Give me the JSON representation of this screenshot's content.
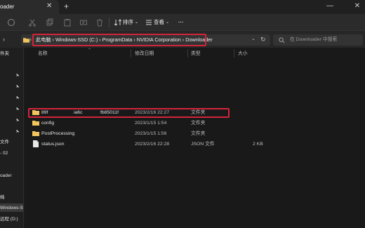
{
  "window": {
    "tab_title": "oader"
  },
  "toolbar": {
    "sort_label": "排序",
    "view_label": "查看",
    "more_label": "···"
  },
  "address": {
    "path": "此电脑 › Windows-SSD (C:) › ProgramData › NVIDIA Corporation › Downloader",
    "search_placeholder": "在 Downloader 中搜索"
  },
  "sidebar": {
    "items": [
      {
        "label": "件夹"
      },
      {
        "label": "文件"
      },
      {
        "label": "- 02"
      },
      {
        "label": "oader"
      },
      {
        "label": "椅"
      },
      {
        "label": "Windows-SSD"
      },
      {
        "label": "远程 (D:)"
      }
    ]
  },
  "columns": {
    "name": "名称",
    "modified": "修改日期",
    "type": "类型",
    "size": "大小"
  },
  "files": [
    {
      "name": "89f",
      "name_mid": "ia6c",
      "name_end": "fb85011f",
      "modified": "2023/2/16 22:27",
      "type": "文件夹",
      "size": "",
      "kind": "folder"
    },
    {
      "name": "config",
      "modified": "2023/1/15 1:54",
      "type": "文件夹",
      "size": "",
      "kind": "folder"
    },
    {
      "name": "PostProcessing",
      "modified": "2023/1/15 1:56",
      "type": "文件夹",
      "size": "",
      "kind": "folder"
    },
    {
      "name": "status.json",
      "modified": "2023/2/16 22:28",
      "type": "JSON 文件",
      "size": "2 KB",
      "kind": "file"
    }
  ],
  "colors": {
    "highlight": "#d3243a",
    "folder": "#f2c55c",
    "background": "#191919"
  }
}
